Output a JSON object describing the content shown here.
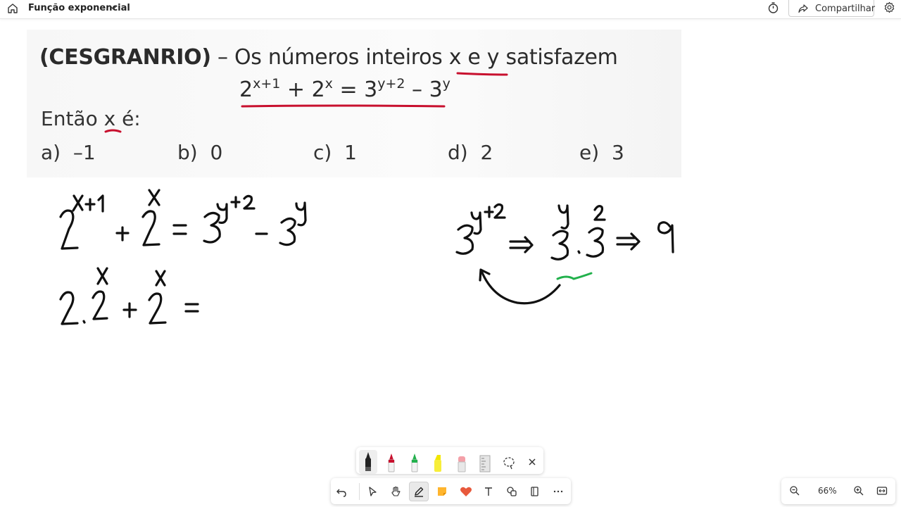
{
  "header": {
    "doc_title": "Função exponencial",
    "share_label": "Compartilhar",
    "icons": [
      "home-icon",
      "chevron-down-icon",
      "timer-icon",
      "share-icon",
      "gear-icon"
    ]
  },
  "problem": {
    "source": "(CESGRANRIO)",
    "statement": " – Os números inteiros x e y satisfazem",
    "equation": {
      "base1": "2",
      "exp1": "x+1",
      "plus": " + ",
      "base2": "2",
      "exp2": "x",
      "equals": " = ",
      "base3": "3",
      "exp3": "y+2",
      "minus": " – ",
      "base4": "3",
      "exp4": "y"
    },
    "question": "Então x é:",
    "options": [
      {
        "label": "a)",
        "value": "–1"
      },
      {
        "label": "b)",
        "value": "0"
      },
      {
        "label": "c)",
        "value": "1"
      },
      {
        "label": "d)",
        "value": "2"
      },
      {
        "label": "e)",
        "value": "3"
      }
    ]
  },
  "annotation_colors": {
    "ink": "#111111",
    "underline": "#c8102e",
    "highlight_green": "#22b14c"
  },
  "pen_tray": [
    "black-pen",
    "red-pen",
    "green-pen",
    "yellow-highlighter",
    "pink-eraser",
    "ruler",
    "lasso-select",
    "close"
  ],
  "toolbar": [
    "undo",
    "select",
    "hand",
    "pen",
    "sticky-note",
    "heart",
    "text",
    "shapes",
    "pages",
    "more"
  ],
  "zoom": {
    "level": "66%",
    "icons": [
      "zoom-out-icon",
      "zoom-in-icon",
      "fit-width-icon"
    ]
  }
}
